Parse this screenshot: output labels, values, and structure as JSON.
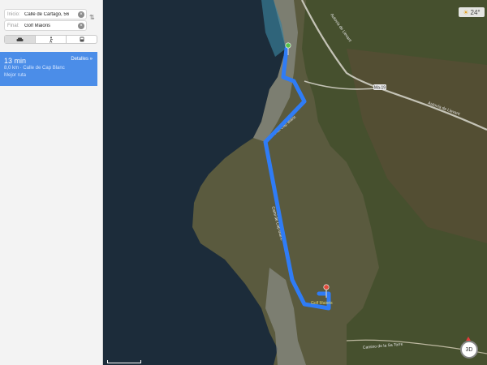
{
  "directions": {
    "start_label": "Inicio:",
    "start_value": "Calle de Cartago, 56",
    "end_label": "Final:",
    "end_value": "Golf Maioris",
    "modes": [
      "car-icon",
      "walk-icon",
      "transit-icon"
    ]
  },
  "route": {
    "time": "13 min",
    "details": "Detalles »",
    "distance": "8,0 km · Calle de Cap Blanc",
    "best": "Mejor ruta"
  },
  "map": {
    "temperature": "24°",
    "three_d": "3D",
    "place_label": "Golf Maioris",
    "roads": {
      "autovia_top": "Autovía de Llevant",
      "autovia_right": "Autovía de Llevant",
      "ma19": "Ma-19",
      "road1": "Calle de Cap Blanc",
      "road2": "Cami de Cap Blanc",
      "bottom": "Camino de la Sa Torre"
    },
    "colors": {
      "route": "#2f7cf6",
      "sea": "#1c2c3a"
    }
  }
}
